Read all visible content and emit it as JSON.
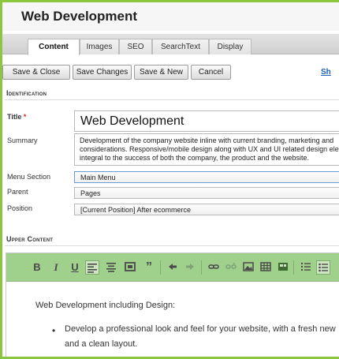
{
  "page": {
    "title": "Web Development"
  },
  "tabs": [
    "Content",
    "Images",
    "SEO",
    "SearchText",
    "Display"
  ],
  "actions": {
    "save_close": "Save & Close",
    "save_changes": "Save Changes",
    "save_new": "Save & New",
    "cancel": "Cancel",
    "show_link": "Sh"
  },
  "identification": {
    "heading": "Identification",
    "title_label": "Title",
    "title_required_mark": "*",
    "title_value": "Web Development",
    "summary_label": "Summary",
    "summary_value": "Development of the company website inline with current branding, marketing and considerations. Responsive/mobile design along with UX and UI related design ele integral to the success of both the company, the product and the website.",
    "menu_section_label": "Menu Section",
    "menu_section_value": "Main Menu",
    "parent_label": "Parent",
    "parent_value": "Pages",
    "position_label": "Position",
    "position_value": "[Current Position] After ecommerce"
  },
  "upper_content": {
    "heading": "Upper Content",
    "toolbar_icons": [
      "bold-icon",
      "italic-icon",
      "underline-icon",
      "align-left-icon",
      "align-center-icon",
      "media-icon",
      "blockquote-icon",
      "undo-icon",
      "redo-icon",
      "link-icon",
      "unlink-icon",
      "image-icon",
      "table-icon",
      "table-cell-icon",
      "ordered-list-icon",
      "unordered-list-icon"
    ],
    "toolbar_glyphs": {
      "bold": "B",
      "italic": "I",
      "underline": "U"
    },
    "body_paragraph": "Web Development including Design:",
    "bullet_line_1": "Develop a professional look and feel for your website, with a fresh new",
    "bullet_line_2": "and a clean layout."
  },
  "colors": {
    "frame_accent": "#8cc63f",
    "editor_toolbar": "#9fd08c",
    "required": "#d9201f",
    "link": "#1a5fb4"
  }
}
